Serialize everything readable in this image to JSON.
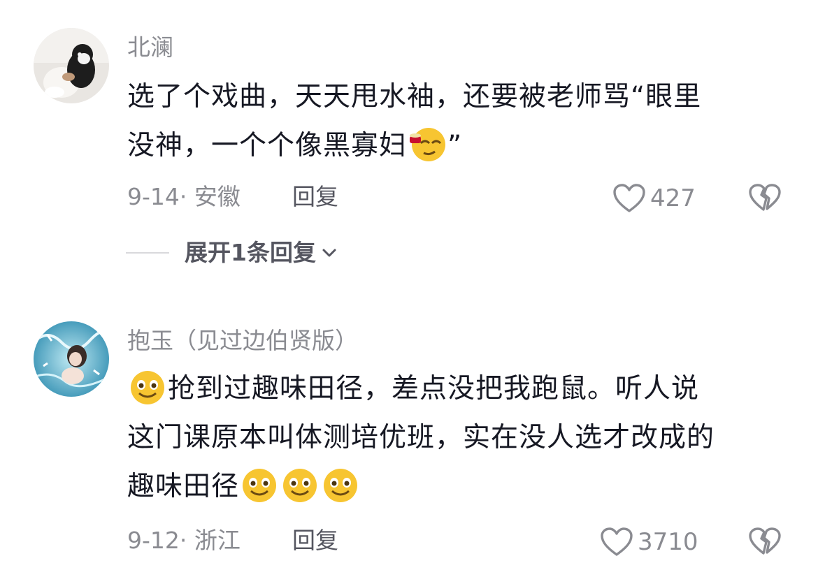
{
  "comments": [
    {
      "username": "北澜",
      "lines": [
        "选了个戏曲，天天甩水袖，还要被老师骂“眼里",
        "没神，一个个像黑寡妇",
        "”"
      ],
      "emoji": "smirk-emoji",
      "date_location": "9-14· 安徽",
      "reply_label": "回复",
      "likes": "427"
    },
    {
      "username": "抱玉（见过边伯贤版）",
      "lines": [
        "抢到过趣味田径，差点没把我跑鼠。听人说",
        "这门课原本叫体测培优班，实在没人选才改成的",
        "趣味田径"
      ],
      "emoji": "smile-emoji",
      "date_location": "9-12· 浙江",
      "reply_label": "回复",
      "likes": "3710"
    }
  ],
  "expand_replies": "展开1条回复",
  "icons": {
    "like": "heart-outline-icon",
    "dislike": "broken-heart-icon",
    "expand": "chevron-down-icon"
  },
  "colors": {
    "text": "#161823",
    "secondary": "#8a8b91",
    "emoji": "#f7c531"
  }
}
